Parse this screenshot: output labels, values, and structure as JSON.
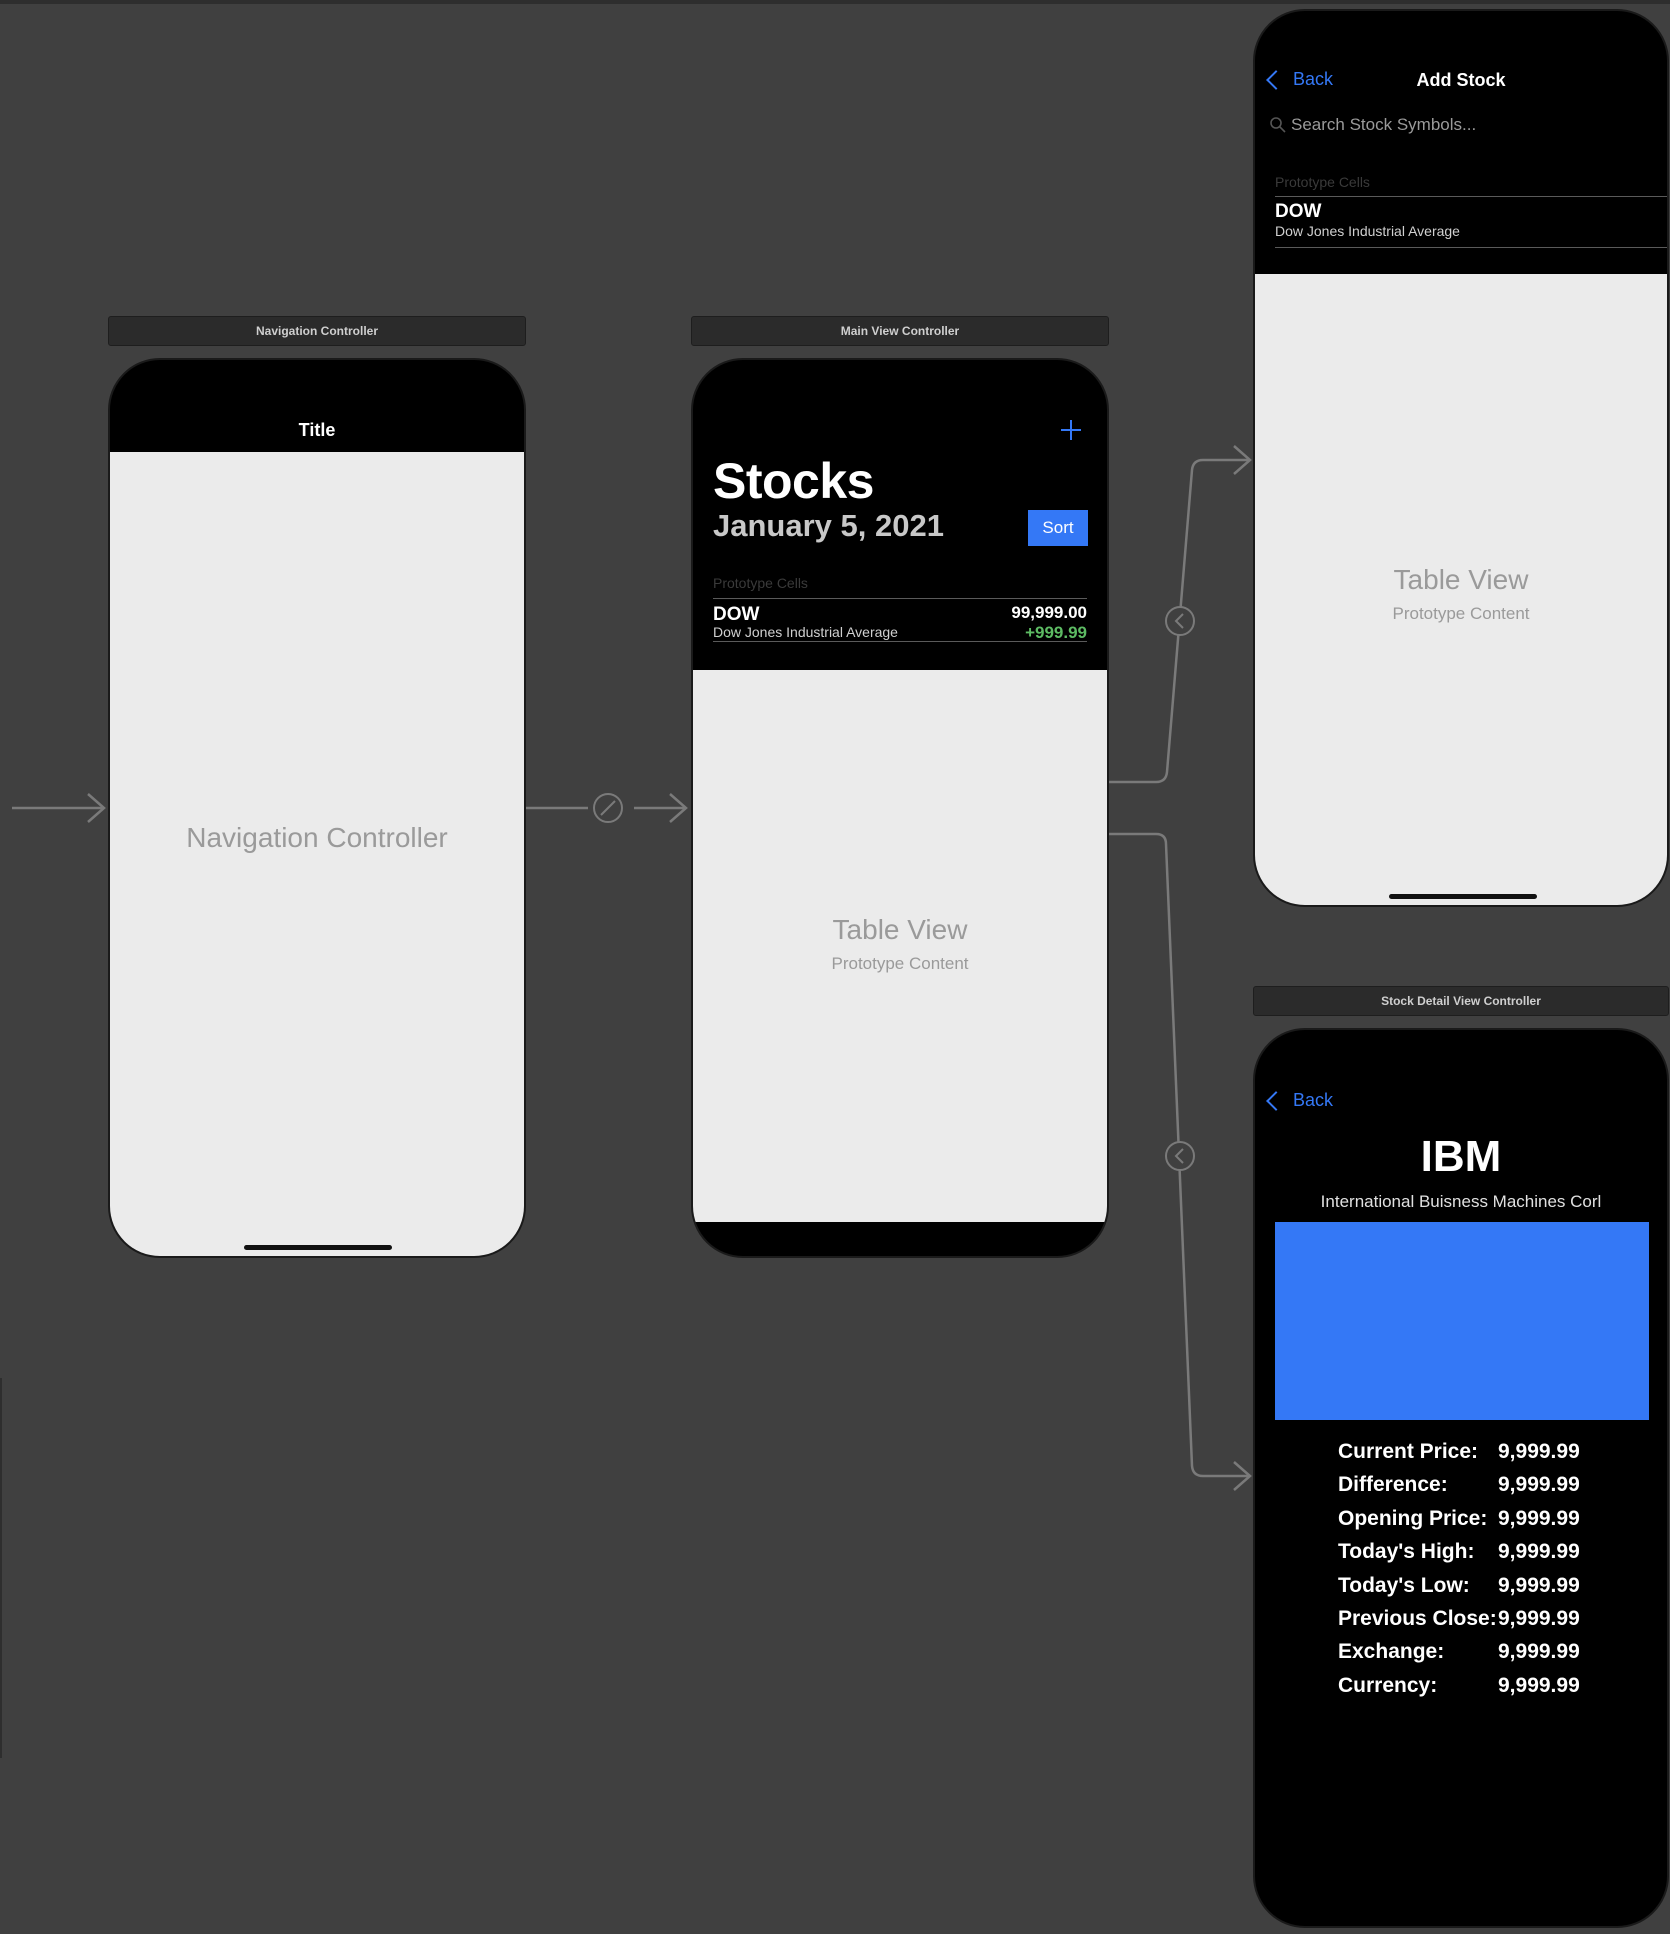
{
  "nav_controller": {
    "scene_label": "Navigation Controller",
    "nav_title": "Title",
    "placeholder": "Navigation Controller"
  },
  "main_vc": {
    "scene_label": "Main View Controller",
    "title": "Stocks",
    "date": "January 5, 2021",
    "sort_button": "Sort",
    "add_icon": "+",
    "prototype_label": "Prototype Cells",
    "cell": {
      "symbol": "DOW",
      "name": "Dow Jones Industrial Average",
      "price": "99,999.00",
      "change": "+999.99"
    },
    "table_title": "Table View",
    "table_sub": "Prototype Content"
  },
  "add_stock": {
    "back": "Back",
    "title": "Add Stock",
    "search_placeholder": "Search Stock Symbols...",
    "prototype_label": "Prototype Cells",
    "cell": {
      "symbol": "DOW",
      "name": "Dow Jones Industrial Average"
    },
    "table_title": "Table View",
    "table_sub": "Prototype Content"
  },
  "detail_vc": {
    "scene_label": "Stock Detail View Controller",
    "back": "Back",
    "symbol": "IBM",
    "company": "International Buisness Machines Corl",
    "chart_color": "#3478f6",
    "rows": [
      {
        "label": "Current Price:",
        "value": "9,999.99"
      },
      {
        "label": "Difference:",
        "value": "9,999.99"
      },
      {
        "label": "Opening Price:",
        "value": "9,999.99"
      },
      {
        "label": "Today's High:",
        "value": "9,999.99"
      },
      {
        "label": "Today's Low:",
        "value": "9,999.99"
      },
      {
        "label": "Previous Close:",
        "value": "9,999.99"
      },
      {
        "label": "Exchange:",
        "value": "9,999.99"
      },
      {
        "label": "Currency:",
        "value": "9,999.99"
      }
    ]
  },
  "colors": {
    "accent": "#3478f6",
    "positive": "#5dbb63",
    "canvas": "#404040"
  }
}
